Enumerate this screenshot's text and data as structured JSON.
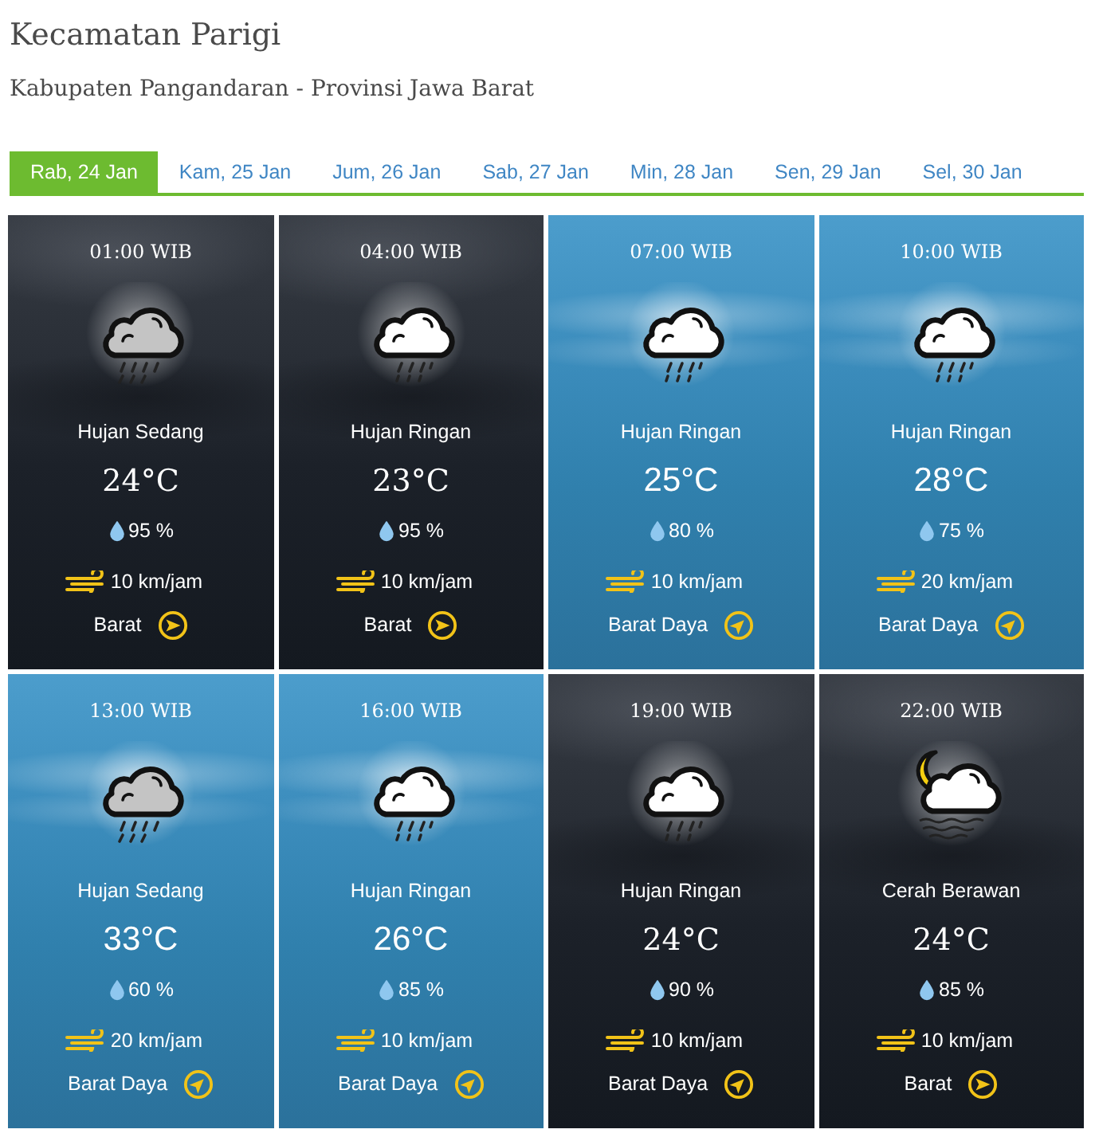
{
  "header": {
    "title": "Kecamatan Parigi",
    "subtitle": "Kabupaten Pangandaran - Provinsi Jawa Barat"
  },
  "day_tabs": [
    {
      "label": "Rab, 24 Jan",
      "selected": true
    },
    {
      "label": "Kam, 25 Jan",
      "selected": false
    },
    {
      "label": "Jum, 26 Jan",
      "selected": false
    },
    {
      "label": "Sab, 27 Jan",
      "selected": false
    },
    {
      "label": "Min, 28 Jan",
      "selected": false
    },
    {
      "label": "Sen, 29 Jan",
      "selected": false
    },
    {
      "label": "Sel, 30 Jan",
      "selected": false
    }
  ],
  "forecasts": [
    {
      "kind": "night",
      "time": "01:00 WIB",
      "weather": {
        "kind": "heavy-rain",
        "label": "Hujan Sedang"
      },
      "temperature": "24°C",
      "humidity": "95 %",
      "wind": {
        "speed": "10 km/jam",
        "direction": "Barat",
        "kind": "east"
      }
    },
    {
      "kind": "night",
      "time": "04:00 WIB",
      "weather": {
        "kind": "light-rain",
        "label": "Hujan Ringan"
      },
      "temperature": "23°C",
      "humidity": "95 %",
      "wind": {
        "speed": "10 km/jam",
        "direction": "Barat",
        "kind": "east"
      }
    },
    {
      "kind": "day",
      "time": "07:00 WIB",
      "weather": {
        "kind": "light-rain",
        "label": "Hujan Ringan"
      },
      "temperature": "25°C",
      "humidity": "80 %",
      "wind": {
        "speed": "10 km/jam",
        "direction": "Barat Daya",
        "kind": "northeast"
      }
    },
    {
      "kind": "day",
      "time": "10:00 WIB",
      "weather": {
        "kind": "light-rain",
        "label": "Hujan Ringan"
      },
      "temperature": "28°C",
      "humidity": "75 %",
      "wind": {
        "speed": "20 km/jam",
        "direction": "Barat Daya",
        "kind": "northeast"
      }
    },
    {
      "kind": "day",
      "time": "13:00 WIB",
      "weather": {
        "kind": "heavy-rain",
        "label": "Hujan Sedang"
      },
      "temperature": "33°C",
      "humidity": "60 %",
      "wind": {
        "speed": "20 km/jam",
        "direction": "Barat Daya",
        "kind": "northeast"
      }
    },
    {
      "kind": "day",
      "time": "16:00 WIB",
      "weather": {
        "kind": "light-rain",
        "label": "Hujan Ringan"
      },
      "temperature": "26°C",
      "humidity": "85 %",
      "wind": {
        "speed": "10 km/jam",
        "direction": "Barat Daya",
        "kind": "northeast"
      }
    },
    {
      "kind": "night",
      "time": "19:00 WIB",
      "weather": {
        "kind": "light-rain",
        "label": "Hujan Ringan"
      },
      "temperature": "24°C",
      "humidity": "90 %",
      "wind": {
        "speed": "10 km/jam",
        "direction": "Barat Daya",
        "kind": "northeast"
      }
    },
    {
      "kind": "night",
      "time": "22:00 WIB",
      "weather": {
        "kind": "cloudy-night",
        "label": "Cerah Berawan"
      },
      "temperature": "24°C",
      "humidity": "85 %",
      "wind": {
        "speed": "10 km/jam",
        "direction": "Barat",
        "kind": "east"
      }
    }
  ]
}
